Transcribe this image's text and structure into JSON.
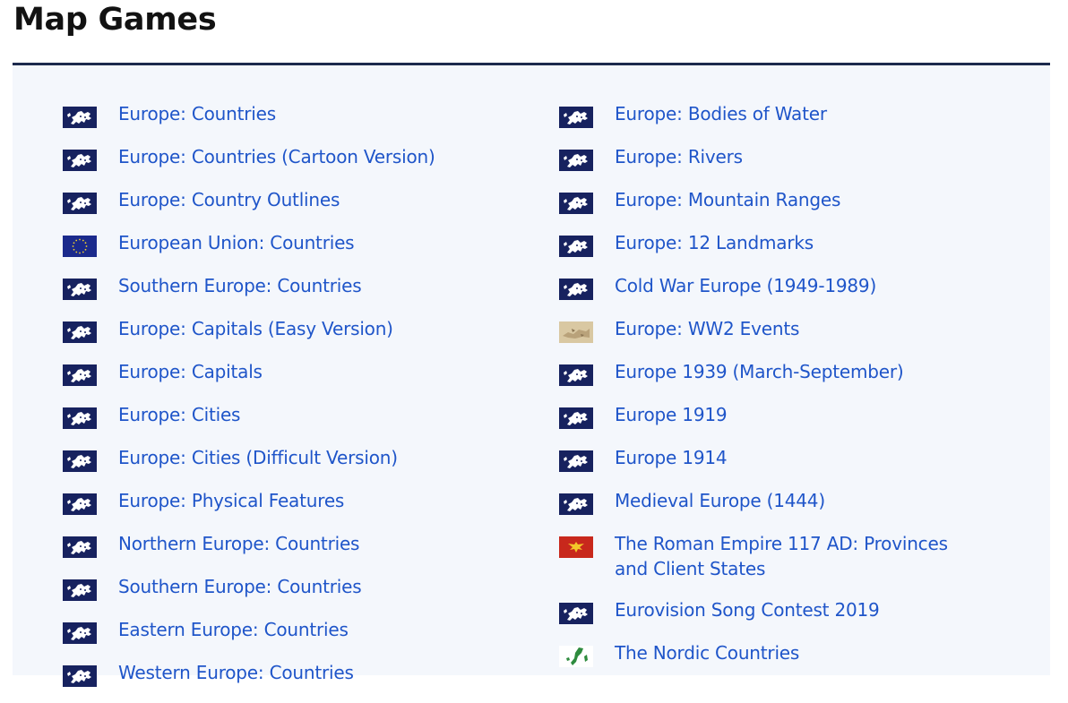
{
  "page": {
    "title": "Map Games"
  },
  "colors": {
    "link": "#1f55c9",
    "panel_bg": "#f4f7fc",
    "rule": "#1c2a4d",
    "title": "#121212"
  },
  "left_column": [
    {
      "label": "Europe: Countries",
      "icon": "europe-map-icon"
    },
    {
      "label": "Europe: Countries (Cartoon Version)",
      "icon": "europe-map-icon"
    },
    {
      "label": "Europe: Country Outlines",
      "icon": "europe-map-icon"
    },
    {
      "label": "European Union: Countries",
      "icon": "eu-flag-icon"
    },
    {
      "label": "Southern Europe: Countries",
      "icon": "europe-map-icon"
    },
    {
      "label": "Europe: Capitals (Easy Version)",
      "icon": "europe-map-icon"
    },
    {
      "label": "Europe: Capitals",
      "icon": "europe-map-icon"
    },
    {
      "label": "Europe: Cities",
      "icon": "europe-map-icon"
    },
    {
      "label": "Europe: Cities (Difficult Version)",
      "icon": "europe-map-icon"
    },
    {
      "label": "Europe: Physical Features",
      "icon": "europe-map-icon"
    },
    {
      "label": "Northern Europe: Countries",
      "icon": "europe-map-icon"
    },
    {
      "label": "Southern Europe: Countries",
      "icon": "europe-map-icon"
    },
    {
      "label": "Eastern Europe: Countries",
      "icon": "europe-map-icon"
    },
    {
      "label": "Western Europe: Countries",
      "icon": "europe-map-icon"
    }
  ],
  "right_column": [
    {
      "label": "Europe: Bodies of Water",
      "icon": "europe-map-icon"
    },
    {
      "label": "Europe: Rivers",
      "icon": "europe-map-icon"
    },
    {
      "label": "Europe: Mountain Ranges",
      "icon": "europe-map-icon"
    },
    {
      "label": "Europe: 12 Landmarks",
      "icon": "europe-map-icon"
    },
    {
      "label": "Cold War Europe (1949-1989)",
      "icon": "europe-map-icon"
    },
    {
      "label": "Europe: WW2 Events",
      "icon": "ww2-map-icon"
    },
    {
      "label": "Europe 1939 (March-September)",
      "icon": "europe-map-icon"
    },
    {
      "label": "Europe 1919",
      "icon": "europe-map-icon"
    },
    {
      "label": "Europe 1914",
      "icon": "europe-map-icon"
    },
    {
      "label": "Medieval Europe (1444)",
      "icon": "europe-map-icon"
    },
    {
      "label": "The Roman Empire 117 AD: Provinces and Client States",
      "icon": "roman-eagle-icon"
    },
    {
      "label": "Eurovision Song Contest 2019",
      "icon": "europe-map-icon"
    },
    {
      "label": "The Nordic Countries",
      "icon": "nordic-map-icon"
    }
  ]
}
